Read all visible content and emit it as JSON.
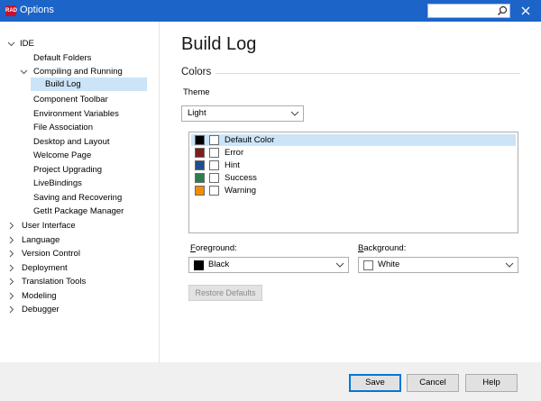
{
  "window": {
    "title": "Options",
    "app_icon_text": "RAD",
    "search_placeholder": ""
  },
  "sidebar": {
    "items": [
      {
        "label": "IDE",
        "expand": "expanded"
      },
      {
        "label": "Default Folders"
      },
      {
        "label": "Compiling and Running",
        "expand": "expanded"
      },
      {
        "label": "Build Log",
        "selected": true
      },
      {
        "label": "Component Toolbar"
      },
      {
        "label": "Environment Variables"
      },
      {
        "label": "File Association"
      },
      {
        "label": "Desktop and Layout"
      },
      {
        "label": "Welcome Page"
      },
      {
        "label": "Project Upgrading"
      },
      {
        "label": "LiveBindings"
      },
      {
        "label": "Saving and Recovering"
      },
      {
        "label": "GetIt Package Manager"
      },
      {
        "label": "User Interface",
        "expand": "collapsed"
      },
      {
        "label": "Language",
        "expand": "collapsed"
      },
      {
        "label": "Version Control",
        "expand": "collapsed"
      },
      {
        "label": "Deployment",
        "expand": "collapsed"
      },
      {
        "label": "Translation Tools",
        "expand": "collapsed"
      },
      {
        "label": "Modeling",
        "expand": "collapsed"
      },
      {
        "label": "Debugger",
        "expand": "collapsed"
      }
    ]
  },
  "main": {
    "title": "Build Log",
    "section": "Colors",
    "theme": {
      "label": "Theme",
      "value": "Light"
    },
    "color_list": [
      {
        "label": "Default Color",
        "color": "#000000",
        "selected": true
      },
      {
        "label": "Error",
        "color": "#7a1f1a"
      },
      {
        "label": "Hint",
        "color": "#1f4e8c"
      },
      {
        "label": "Success",
        "color": "#2e7d4f"
      },
      {
        "label": "Warning",
        "color": "#f28c00"
      }
    ],
    "foreground": {
      "label_accel": "F",
      "label_rest": "oreground:",
      "value": "Black",
      "color": "#000000"
    },
    "background": {
      "label_accel": "B",
      "label_rest": "ackground:",
      "value": "White",
      "color": "#ffffff"
    },
    "restore_defaults": "Restore Defaults"
  },
  "footer": {
    "save": "Save",
    "cancel": "Cancel",
    "help": "Help"
  },
  "colors": {
    "titlebar": "#1c64c8",
    "selection": "#cce4f7",
    "footer": "#f0f0f0"
  }
}
